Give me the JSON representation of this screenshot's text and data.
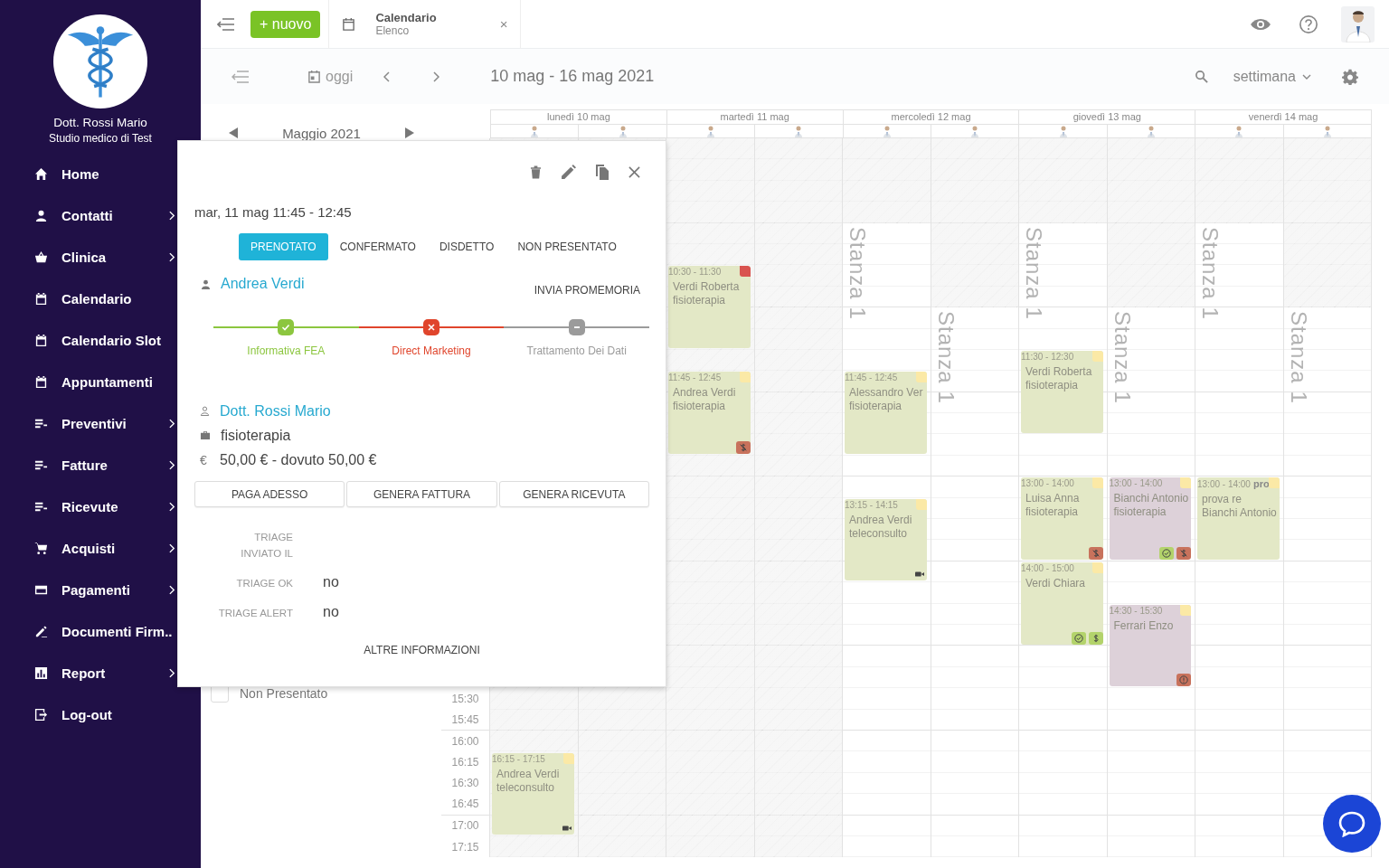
{
  "sidebar": {
    "doctor_name": "Dott. Rossi Mario",
    "studio": "Studio medico di Test",
    "items": [
      {
        "label": "Home",
        "kind": "home",
        "has_submenu": false
      },
      {
        "label": "Contatti",
        "kind": "person",
        "has_submenu": true
      },
      {
        "label": "Clinica",
        "kind": "basket",
        "has_submenu": true
      },
      {
        "label": "Calendario",
        "kind": "calendar",
        "has_submenu": false
      },
      {
        "label": "Calendario Slot",
        "kind": "calendar",
        "has_submenu": false
      },
      {
        "label": "Appuntamenti",
        "kind": "calendar",
        "has_submenu": false
      },
      {
        "label": "Preventivi",
        "kind": "list",
        "has_submenu": true
      },
      {
        "label": "Fatture",
        "kind": "list",
        "has_submenu": true
      },
      {
        "label": "Ricevute",
        "kind": "list",
        "has_submenu": true
      },
      {
        "label": "Acquisti",
        "kind": "cart",
        "has_submenu": true
      },
      {
        "label": "Pagamenti",
        "kind": "card",
        "has_submenu": true
      },
      {
        "label": "Documenti Firm..",
        "kind": "pen",
        "has_submenu": false
      },
      {
        "label": "Report",
        "kind": "chart",
        "has_submenu": true
      },
      {
        "label": "Log-out",
        "kind": "logout",
        "has_submenu": false
      }
    ]
  },
  "topbar": {
    "new_button": "+ nuovo",
    "tab": {
      "title": "Calendario",
      "subtitle": "Elenco",
      "close": "×"
    }
  },
  "toolbar": {
    "today": "oggi",
    "range": "10 mag - 16 mag 2021",
    "view": "settimana"
  },
  "left_panel": {
    "month": "Maggio 2021",
    "filters": [
      {
        "label": "Non Presentato",
        "checked": false
      }
    ]
  },
  "calendar": {
    "time_labels": [
      "15:30",
      "15:45",
      "16:00",
      "16:15",
      "16:30",
      "16:45",
      "17:00",
      "17:15"
    ],
    "days": [
      {
        "label": "lunedì 10 mag",
        "columns": [
          {
            "kind": "closed",
            "events": [
              {
                "time": "16:15 - 17:15",
                "lines": [
                  "Andrea Verdi",
                  "teleconsulto"
                ],
                "color": "#e3e8c6",
                "flagged": false,
                "badges": [
                  {
                    "kind": "video"
                  }
                ]
              }
            ]
          },
          {
            "kind": "closed"
          }
        ]
      },
      {
        "label": "martedì 11 mag",
        "columns": [
          {
            "kind": "closed",
            "events": [
              {
                "time": "10:30 - 11:30",
                "lines": [
                  "Verdi Roberta",
                  "fisioterapia"
                ],
                "color": "#e3e8c6",
                "flagged": true
              },
              {
                "time": "11:45 - 12:45",
                "lines": [
                  "Andrea Verdi",
                  "fisioterapia"
                ],
                "color": "#e3e8c6",
                "flagged": false,
                "badges": [
                  {
                    "kind": "unpaid"
                  }
                ]
              }
            ]
          },
          {
            "kind": "closed"
          }
        ]
      },
      {
        "label": "mercoledì 12 mag",
        "columns": [
          {
            "kind": "opens_early",
            "room": "Stanza 1",
            "events": [
              {
                "time": "11:45 - 12:45",
                "lines": [
                  "Alessandro Ver",
                  "fisioterapia"
                ],
                "color": "#e3e8c6",
                "flagged": false
              },
              {
                "time": "13:15 - 14:15",
                "lines": [
                  "Andrea Verdi",
                  "teleconsulto"
                ],
                "color": "#e3e8c6",
                "flagged": false,
                "badges": [
                  {
                    "kind": "video"
                  }
                ]
              }
            ]
          },
          {
            "kind": "opens_late",
            "room": "Stanza 1"
          }
        ]
      },
      {
        "label": "giovedì 13 mag",
        "columns": [
          {
            "kind": "opens_early",
            "room": "Stanza 1",
            "events": [
              {
                "time": "11:30 - 12:30",
                "lines": [
                  "Verdi Roberta",
                  "fisioterapia"
                ],
                "color": "#e3e8c6",
                "flagged": false
              },
              {
                "time": "13:00 - 14:00",
                "lines": [
                  "Luisa Anna",
                  "fisioterapia"
                ],
                "color": "#e3e8c6",
                "flagged": false,
                "badges": [
                  {
                    "kind": "unpaid"
                  }
                ]
              },
              {
                "time": "14:00 - 15:00",
                "lines": [
                  "Verdi Chiara"
                ],
                "color": "#e3e8c6",
                "flagged": false,
                "badges": [
                  {
                    "kind": "confirmed"
                  },
                  {
                    "kind": "paid"
                  }
                ]
              }
            ]
          },
          {
            "kind": "opens_late",
            "room": "Stanza 1",
            "events": [
              {
                "time": "13:00 - 14:00",
                "lines": [
                  "Bianchi Antonio",
                  "fisioterapia"
                ],
                "color": "#ddd1d9",
                "flagged": false,
                "badges": [
                  {
                    "kind": "confirmed"
                  },
                  {
                    "kind": "unpaid"
                  }
                ]
              },
              {
                "time": "14:30 - 15:30",
                "lines": [
                  "Ferrari Enzo"
                ],
                "color": "#ddd1d9",
                "flagged": false,
                "badges": [
                  {
                    "kind": "alert"
                  }
                ]
              }
            ]
          }
        ]
      },
      {
        "label": "venerdì 14 mag",
        "columns": [
          {
            "kind": "opens_early",
            "room": "Stanza 1",
            "events": [
              {
                "time": "13:00 - 14:00",
                "title": "pro",
                "lines": [
                  "prova re",
                  "Bianchi Antonio"
                ],
                "color": "#e3e8c6",
                "flagged": false
              }
            ]
          },
          {
            "kind": "opens_late",
            "room": "Stanza 1"
          }
        ]
      }
    ]
  },
  "popup": {
    "date": "mar, 11 mag 11:45 - 12:45",
    "statuses": [
      {
        "label": "PRENOTATO",
        "selected": true
      },
      {
        "label": "CONFERMATO",
        "selected": false
      },
      {
        "label": "DISDETTO",
        "selected": false
      },
      {
        "label": "NON PRESENTATO",
        "selected": false
      }
    ],
    "patient": "Andrea Verdi",
    "reminder": "INVIA PROMEMORIA",
    "consents": [
      {
        "label": "Informativa FEA",
        "kind": "accepted"
      },
      {
        "label": "Direct Marketing",
        "kind": "refused"
      },
      {
        "label": "Trattamento Dei Dati",
        "kind": "missing"
      }
    ],
    "doctor": "Dott. Rossi Mario",
    "service": "fisioterapia",
    "price_symbol": "€",
    "price": "50,00 € - dovuto 50,00 €",
    "actions": [
      "PAGA ADESSO",
      "GENERA FATTURA",
      "GENERA RICEVUTA"
    ],
    "triage": [
      {
        "label": "TRIAGE INVIATO IL"
      },
      {
        "label": "TRIAGE OK",
        "value": "no"
      },
      {
        "label": "TRIAGE ALERT",
        "value": "no"
      }
    ],
    "more": "ALTRE INFORMAZIONI"
  }
}
